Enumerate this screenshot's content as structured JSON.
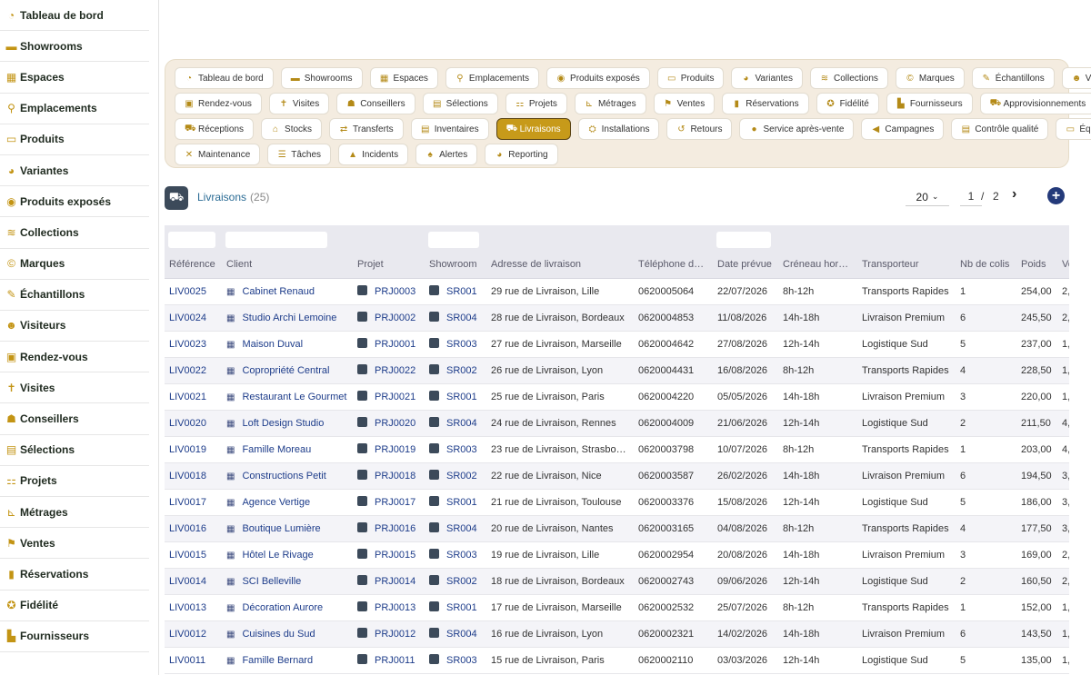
{
  "sidebar": {
    "items": [
      {
        "label": "Tableau de bord",
        "icon": "gauge-icon"
      },
      {
        "label": "Showrooms",
        "icon": "store-icon"
      },
      {
        "label": "Espaces",
        "icon": "grid-icon"
      },
      {
        "label": "Emplacements",
        "icon": "map-pin-icon"
      },
      {
        "label": "Produits",
        "icon": "couch-icon"
      },
      {
        "label": "Variantes",
        "icon": "palette-icon"
      },
      {
        "label": "Produits exposés",
        "icon": "eye-icon"
      },
      {
        "label": "Collections",
        "icon": "layers-icon"
      },
      {
        "label": "Marques",
        "icon": "copyright-icon"
      },
      {
        "label": "Échantillons",
        "icon": "eyedropper-icon"
      },
      {
        "label": "Visiteurs",
        "icon": "users-icon"
      },
      {
        "label": "Rendez-vous",
        "icon": "calendar-check-icon"
      },
      {
        "label": "Visites",
        "icon": "walking-icon"
      },
      {
        "label": "Conseillers",
        "icon": "user-tie-icon"
      },
      {
        "label": "Sélections",
        "icon": "clipboard-check-icon"
      },
      {
        "label": "Projets",
        "icon": "project-diagram-icon"
      },
      {
        "label": "Métrages",
        "icon": "ruler-icon"
      },
      {
        "label": "Ventes",
        "icon": "handshake-icon"
      },
      {
        "label": "Réservations",
        "icon": "bookmark-icon"
      },
      {
        "label": "Fidélité",
        "icon": "award-icon"
      },
      {
        "label": "Fournisseurs",
        "icon": "industry-icon"
      }
    ]
  },
  "tabs": {
    "rows": [
      [
        {
          "label": "Tableau de bord",
          "icon": "gauge-icon",
          "glyph": "◔"
        },
        {
          "label": "Showrooms",
          "icon": "store-icon",
          "glyph": "▬"
        },
        {
          "label": "Espaces",
          "icon": "grid-icon",
          "glyph": "▦"
        },
        {
          "label": "Emplacements",
          "icon": "map-pin-icon",
          "glyph": "⚲"
        },
        {
          "label": "Produits exposés",
          "icon": "eye-icon",
          "glyph": "◉"
        },
        {
          "label": "Produits",
          "icon": "couch-icon",
          "glyph": "▭"
        },
        {
          "label": "Variantes",
          "icon": "palette-icon",
          "glyph": "◕"
        },
        {
          "label": "Collections",
          "icon": "layers-icon",
          "glyph": "≋"
        },
        {
          "label": "Marques",
          "icon": "copyright-icon",
          "glyph": "©"
        },
        {
          "label": "Échantillons",
          "icon": "eyedropper-icon",
          "glyph": "✎"
        },
        {
          "label": "Visiteurs",
          "icon": "users-icon",
          "glyph": "☻"
        }
      ],
      [
        {
          "label": "Rendez-vous",
          "icon": "calendar-check-icon",
          "glyph": "▣"
        },
        {
          "label": "Visites",
          "icon": "walking-icon",
          "glyph": "✝"
        },
        {
          "label": "Conseillers",
          "icon": "user-tie-icon",
          "glyph": "☗"
        },
        {
          "label": "Sélections",
          "icon": "clipboard-check-icon",
          "glyph": "▤"
        },
        {
          "label": "Projets",
          "icon": "project-diagram-icon",
          "glyph": "⚏"
        },
        {
          "label": "Métrages",
          "icon": "ruler-icon",
          "glyph": "⊾"
        },
        {
          "label": "Ventes",
          "icon": "handshake-icon",
          "glyph": "⚑"
        },
        {
          "label": "Réservations",
          "icon": "bookmark-icon",
          "glyph": "▮"
        },
        {
          "label": "Fidélité",
          "icon": "award-icon",
          "glyph": "✪"
        },
        {
          "label": "Fournisseurs",
          "icon": "industry-icon",
          "glyph": "▙"
        },
        {
          "label": "Approvisionnements",
          "icon": "dolly-icon",
          "glyph": "⛟"
        }
      ],
      [
        {
          "label": "Réceptions",
          "icon": "truck-loading-icon",
          "glyph": "⛟"
        },
        {
          "label": "Stocks",
          "icon": "warehouse-icon",
          "glyph": "⌂"
        },
        {
          "label": "Transferts",
          "icon": "exchange-icon",
          "glyph": "⇄"
        },
        {
          "label": "Inventaires",
          "icon": "clipboard-list-icon",
          "glyph": "▤"
        },
        {
          "label": "Livraisons",
          "icon": "shipping-fast-icon",
          "glyph": "⛟",
          "active": true
        },
        {
          "label": "Installations",
          "icon": "tools-icon",
          "glyph": "⛭"
        },
        {
          "label": "Retours",
          "icon": "undo-icon",
          "glyph": "↺"
        },
        {
          "label": "Service après-vente",
          "icon": "comment-icon",
          "glyph": "●"
        },
        {
          "label": "Campagnes",
          "icon": "bullhorn-icon",
          "glyph": "◀"
        },
        {
          "label": "Contrôle qualité",
          "icon": "clipboard-check-icon",
          "glyph": "▤"
        },
        {
          "label": "Équipements",
          "icon": "desktop-icon",
          "glyph": "▭"
        }
      ],
      [
        {
          "label": "Maintenance",
          "icon": "wrench-icon",
          "glyph": "✕"
        },
        {
          "label": "Tâches",
          "icon": "tasks-icon",
          "glyph": "☰"
        },
        {
          "label": "Incidents",
          "icon": "warning-icon",
          "glyph": "▲"
        },
        {
          "label": "Alertes",
          "icon": "bell-icon",
          "glyph": "♠"
        },
        {
          "label": "Reporting",
          "icon": "chart-pie-icon",
          "glyph": "◕"
        }
      ]
    ]
  },
  "header": {
    "title": "Livraisons",
    "count": "(25)",
    "page_size": "20",
    "page_current": "1",
    "page_sep": "/",
    "page_total": "2"
  },
  "table": {
    "columns": [
      "Référence",
      "Client",
      "Projet",
      "Showroom",
      "Adresse de livraison",
      "Téléphone d…",
      "Date prévue",
      "Créneau hor…",
      "Transporteur",
      "Nb de colis",
      "Poids",
      "Vo"
    ],
    "rows": [
      [
        "LIV0025",
        "Cabinet Renaud",
        "PRJ0003",
        "SR001",
        "29 rue de Livraison, Lille",
        "0620005064",
        "22/07/2026",
        "8h-12h",
        "Transports Rapides",
        "1",
        "254,00",
        "2,"
      ],
      [
        "LIV0024",
        "Studio Archi Lemoine",
        "PRJ0002",
        "SR004",
        "28 rue de Livraison, Bordeaux",
        "0620004853",
        "11/08/2026",
        "14h-18h",
        "Livraison Premium",
        "6",
        "245,50",
        "2,"
      ],
      [
        "LIV0023",
        "Maison Duval",
        "PRJ0001",
        "SR003",
        "27 rue de Livraison, Marseille",
        "0620004642",
        "27/08/2026",
        "12h-14h",
        "Logistique Sud",
        "5",
        "237,00",
        "1,"
      ],
      [
        "LIV0022",
        "Copropriété Central",
        "PRJ0022",
        "SR002",
        "26 rue de Livraison, Lyon",
        "0620004431",
        "16/08/2026",
        "8h-12h",
        "Transports Rapides",
        "4",
        "228,50",
        "1,"
      ],
      [
        "LIV0021",
        "Restaurant Le Gourmet",
        "PRJ0021",
        "SR001",
        "25 rue de Livraison, Paris",
        "0620004220",
        "05/05/2026",
        "14h-18h",
        "Livraison Premium",
        "3",
        "220,00",
        "1,"
      ],
      [
        "LIV0020",
        "Loft Design Studio",
        "PRJ0020",
        "SR004",
        "24 rue de Livraison, Rennes",
        "0620004009",
        "21/06/2026",
        "12h-14h",
        "Logistique Sud",
        "2",
        "211,50",
        "4,"
      ],
      [
        "LIV0019",
        "Famille Moreau",
        "PRJ0019",
        "SR003",
        "23 rue de Livraison, Strasbo…",
        "0620003798",
        "10/07/2026",
        "8h-12h",
        "Transports Rapides",
        "1",
        "203,00",
        "4,"
      ],
      [
        "LIV0018",
        "Constructions Petit",
        "PRJ0018",
        "SR002",
        "22 rue de Livraison, Nice",
        "0620003587",
        "26/02/2026",
        "14h-18h",
        "Livraison Premium",
        "6",
        "194,50",
        "3,"
      ],
      [
        "LIV0017",
        "Agence Vertige",
        "PRJ0017",
        "SR001",
        "21 rue de Livraison, Toulouse",
        "0620003376",
        "15/08/2026",
        "12h-14h",
        "Logistique Sud",
        "5",
        "186,00",
        "3,"
      ],
      [
        "LIV0016",
        "Boutique Lumière",
        "PRJ0016",
        "SR004",
        "20 rue de Livraison, Nantes",
        "0620003165",
        "04/08/2026",
        "8h-12h",
        "Transports Rapides",
        "4",
        "177,50",
        "3,"
      ],
      [
        "LIV0015",
        "Hôtel Le Rivage",
        "PRJ0015",
        "SR003",
        "19 rue de Livraison, Lille",
        "0620002954",
        "20/08/2026",
        "14h-18h",
        "Livraison Premium",
        "3",
        "169,00",
        "2,"
      ],
      [
        "LIV0014",
        "SCI Belleville",
        "PRJ0014",
        "SR002",
        "18 rue de Livraison, Bordeaux",
        "0620002743",
        "09/06/2026",
        "12h-14h",
        "Logistique Sud",
        "2",
        "160,50",
        "2,"
      ],
      [
        "LIV0013",
        "Décoration Aurore",
        "PRJ0013",
        "SR001",
        "17 rue de Livraison, Marseille",
        "0620002532",
        "25/07/2026",
        "8h-12h",
        "Transports Rapides",
        "1",
        "152,00",
        "1,"
      ],
      [
        "LIV0012",
        "Cuisines du Sud",
        "PRJ0012",
        "SR004",
        "16 rue de Livraison, Lyon",
        "0620002321",
        "14/02/2026",
        "14h-18h",
        "Livraison Premium",
        "6",
        "143,50",
        "1,"
      ],
      [
        "LIV0011",
        "Famille Bernard",
        "PRJ0011",
        "SR003",
        "15 rue de Livraison, Paris",
        "0620002110",
        "03/03/2026",
        "12h-14h",
        "Logistique Sud",
        "5",
        "135,00",
        "1,"
      ]
    ]
  }
}
